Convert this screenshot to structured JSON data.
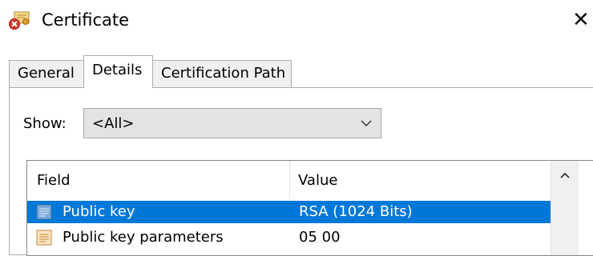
{
  "window": {
    "title": "Certificate",
    "icon": "certificate-error-icon",
    "close_glyph": "✕"
  },
  "tabs": [
    {
      "label": "General",
      "selected": false
    },
    {
      "label": "Details",
      "selected": true
    },
    {
      "label": "Certification Path",
      "selected": false
    }
  ],
  "show": {
    "label": "Show:",
    "selected_value": "<All>"
  },
  "list": {
    "columns": [
      "Field",
      "Value"
    ],
    "rows": [
      {
        "field": "Public key",
        "value": "RSA (1024 Bits)",
        "selected": true,
        "icon": "field-icon"
      },
      {
        "field": "Public key parameters",
        "value": "05 00",
        "selected": false,
        "icon": "field-icon"
      }
    ]
  },
  "colors": {
    "selection": "#0078d7",
    "tab_background": "#f0f0f0",
    "border": "#adadad"
  }
}
